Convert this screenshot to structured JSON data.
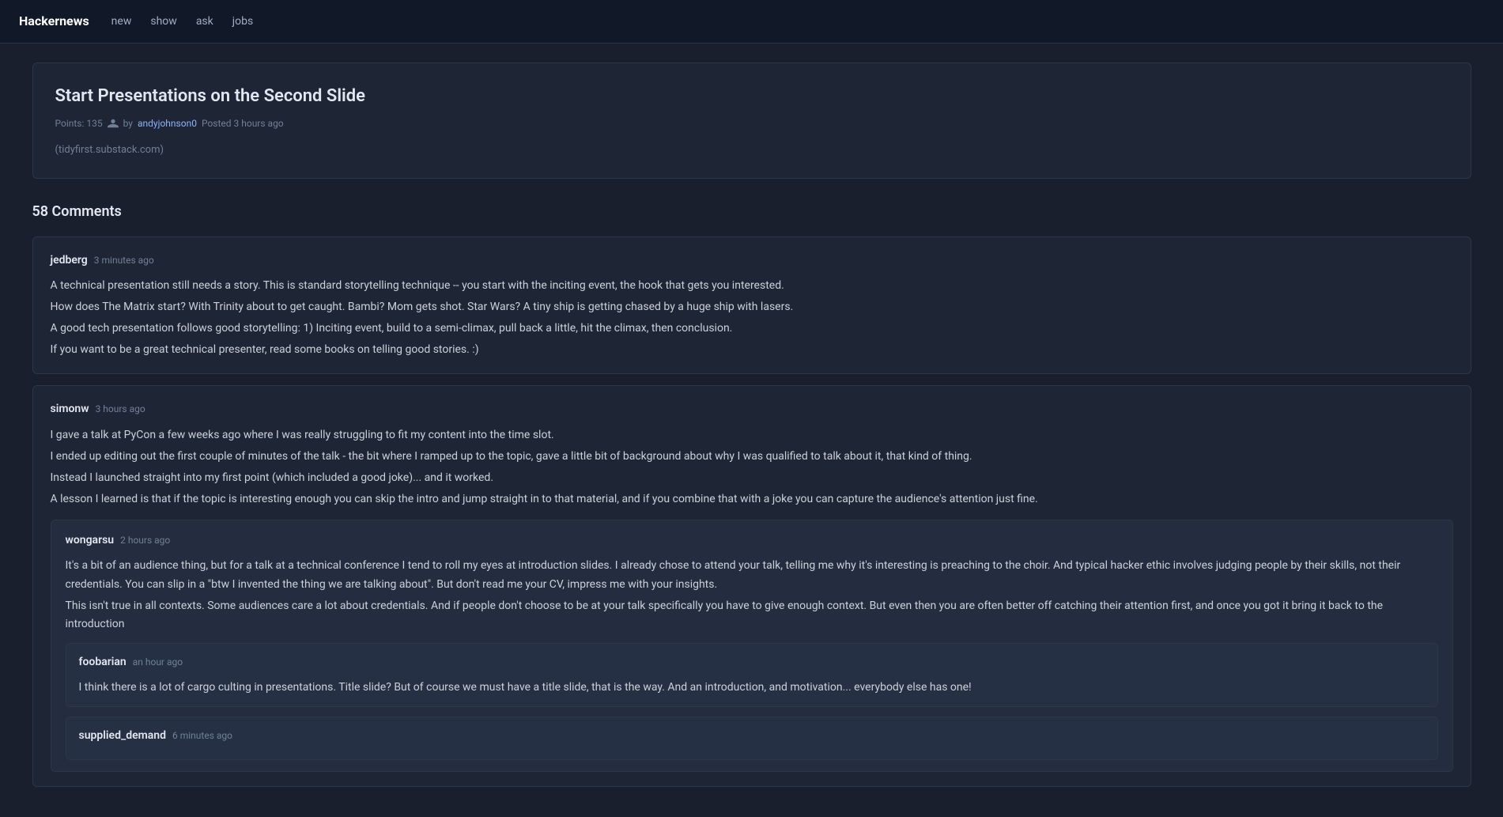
{
  "header": {
    "brand": "Hackernews",
    "nav": [
      {
        "label": "new",
        "href": "#"
      },
      {
        "label": "show",
        "href": "#"
      },
      {
        "label": "ask",
        "href": "#"
      },
      {
        "label": "jobs",
        "href": "#"
      }
    ]
  },
  "article": {
    "title": "Start Presentations on the Second Slide",
    "points_label": "Points: 135",
    "by_label": "by",
    "author": "andyjohnson0",
    "posted": "Posted 3 hours ago",
    "domain": "(tidyfirst.substack.com)"
  },
  "comments_section": {
    "count_label": "58 Comments"
  },
  "comments": [
    {
      "id": "jedberg",
      "author": "jedberg",
      "time": "3 minutes ago",
      "body_lines": [
        "A technical presentation still needs a story. This is standard storytelling technique -- you start with the inciting event, the hook that gets you interested.",
        "How does The Matrix start? With Trinity about to get caught. Bambi? Mom gets shot. Star Wars? A tiny ship is getting chased by a huge ship with lasers.",
        "A good tech presentation follows good storytelling: 1) Inciting event, build to a semi-climax, pull back a little, hit the climax, then conclusion.",
        "If you want to be a great technical presenter, read some books on telling good stories. :)"
      ],
      "nested": []
    },
    {
      "id": "simonw",
      "author": "simonw",
      "time": "3 hours ago",
      "body_lines": [
        "I gave a talk at PyCon a few weeks ago where I was really struggling to fit my content into the time slot.",
        "I ended up editing out the first couple of minutes of the talk - the bit where I ramped up to the topic, gave a little bit of background about why I was qualified to talk about it, that kind of thing.",
        "Instead I launched straight into my first point (which included a good joke)... and it worked.",
        "A lesson I learned is that if the topic is interesting enough you can skip the intro and jump straight in to that material, and if you combine that with a joke you can capture the audience's attention just fine."
      ],
      "nested": [
        {
          "id": "wongarsu",
          "author": "wongarsu",
          "time": "2 hours ago",
          "body_lines": [
            "It's a bit of an audience thing, but for a talk at a technical conference I tend to roll my eyes at introduction slides. I already chose to attend your talk, telling me why it's interesting is preaching to the choir. And typical hacker ethic involves judging people by their skills, not their credentials. You can slip in a \"btw I invented the thing we are talking about\". But don't read me your CV, impress me with your insights.",
            "This isn't true in all contexts. Some audiences care a lot about credentials. And if people don't choose to be at your talk specifically you have to give enough context. But even then you are often better off catching their attention first, and once you got it bring it back to the introduction"
          ],
          "nested": [
            {
              "id": "foobarian",
              "author": "foobarian",
              "time": "an hour ago",
              "body_lines": [
                "I think there is a lot of cargo culting in presentations. Title slide? But of course we must have a title slide, that is the way. And an introduction, and motivation... everybody else has one!"
              ]
            },
            {
              "id": "supplied_demand",
              "author": "supplied_demand",
              "time": "6 minutes ago",
              "body_lines": []
            }
          ]
        }
      ]
    }
  ]
}
